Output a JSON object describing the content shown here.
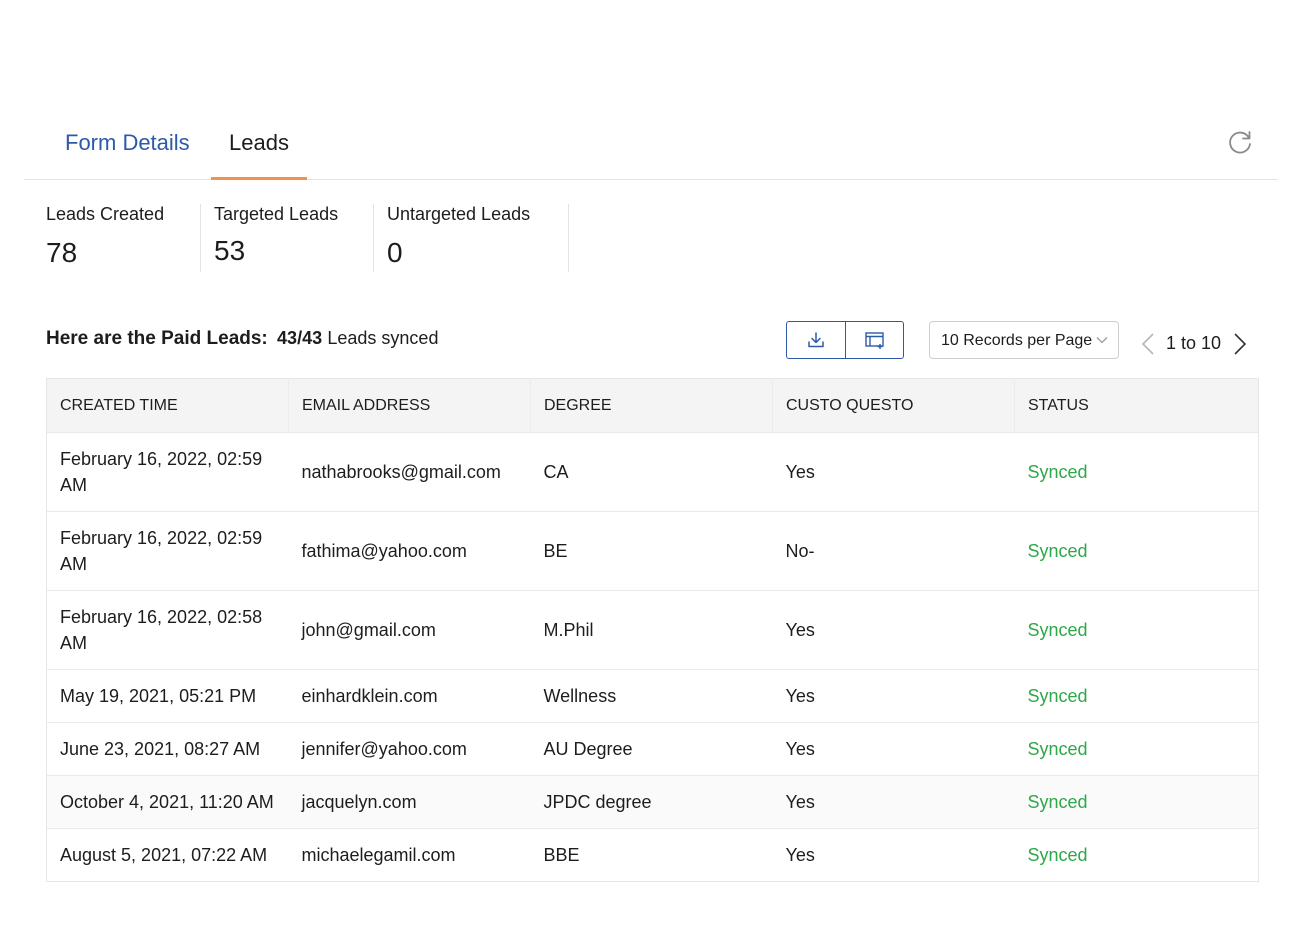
{
  "tabs": [
    {
      "label": "Form Details",
      "active": false
    },
    {
      "label": "Leads",
      "active": true
    }
  ],
  "stats": [
    {
      "label": "Leads Created",
      "value": "78"
    },
    {
      "label": "Targeted Leads",
      "value": "53"
    },
    {
      "label": "Untargeted Leads",
      "value": "0"
    }
  ],
  "summary": {
    "heading": "Here are the Paid Leads:",
    "count": "43/43",
    "tail": "Leads synced"
  },
  "toolbar": {
    "download_icon": "download-icon",
    "columns_icon": "column-settings-icon"
  },
  "pagination": {
    "records_per_page": "10 Records per Page",
    "range": "1 to 10"
  },
  "table": {
    "columns": [
      "CREATED TIME",
      "EMAIL ADDRESS",
      "DEGREE",
      "CUSTO QUESTO",
      "STATUS"
    ],
    "rows": [
      {
        "created": "February 16, 2022, 02:59 AM",
        "email": "nathabrooks@gmail.com",
        "degree": "CA",
        "custom": "Yes",
        "status": "Synced"
      },
      {
        "created": "February 16, 2022, 02:59 AM",
        "email": "fathima@yahoo.com",
        "degree": "BE",
        "custom": "No-",
        "status": "Synced"
      },
      {
        "created": "February 16, 2022, 02:58 AM",
        "email": "john@gmail.com",
        "degree": "M.Phil",
        "custom": "Yes",
        "status": "Synced"
      },
      {
        "created": "May 19, 2021, 05:21 PM",
        "email": "einhardklein.com",
        "degree": "Wellness",
        "custom": "Yes",
        "status": "Synced"
      },
      {
        "created": "June 23, 2021, 08:27 AM",
        "email": "jennifer@yahoo.com",
        "degree": "AU Degree",
        "custom": "Yes",
        "status": "Synced"
      },
      {
        "created": "October 4, 2021, 11:20 AM",
        "email": "jacquelyn.com",
        "degree": "JPDC degree",
        "custom": "Yes",
        "status": "Synced"
      },
      {
        "created": "August 5, 2021, 07:22 AM",
        "email": "michaelegamil.com",
        "degree": "BBE",
        "custom": "Yes",
        "status": "Synced"
      }
    ]
  },
  "colors": {
    "accent_blue": "#2d5aa8",
    "active_tab_underline": "#f0914d",
    "status_synced": "#2ea84a"
  }
}
